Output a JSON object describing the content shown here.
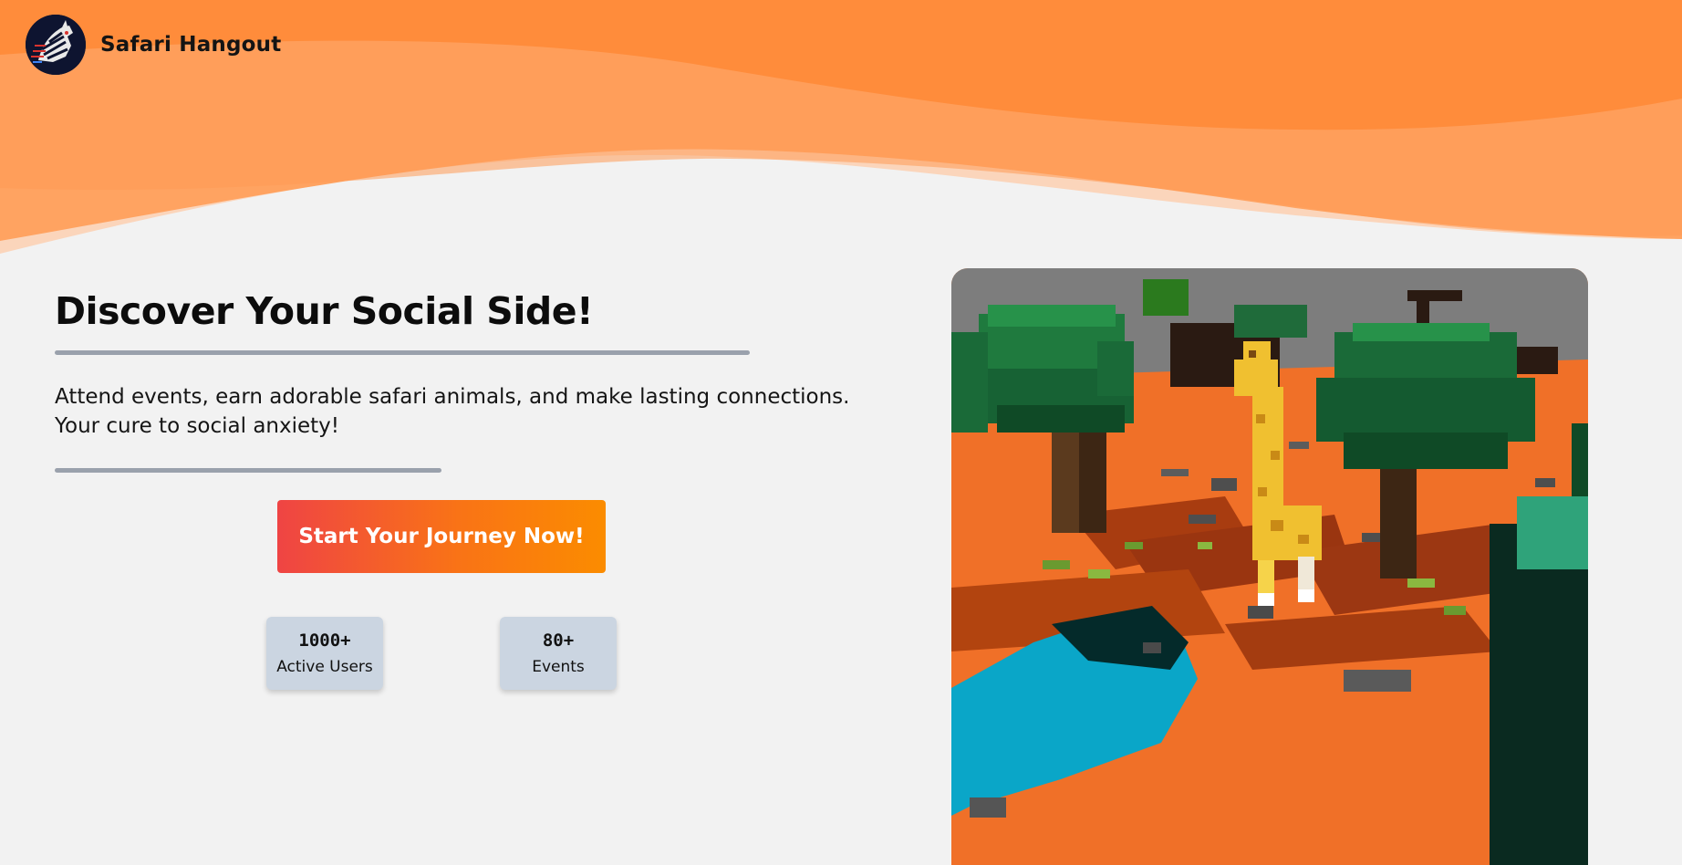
{
  "brand": {
    "name": "Safari Hangout",
    "logo_icon": "zebra-logo-icon"
  },
  "hero": {
    "title": "Discover Your Social Side!",
    "description_line1": "Attend events, earn adorable safari animals, and make lasting connections.",
    "description_line2": "Your cure to social anxiety!",
    "cta_label": "Start Your Journey Now!"
  },
  "stats": [
    {
      "value": "1000+",
      "label": "Active Users"
    },
    {
      "value": "80+",
      "label": "Events"
    }
  ],
  "scene": {
    "description_icon": "voxel-safari-giraffe-scene"
  },
  "colors": {
    "header_orange": "#ff8c3b",
    "page_background": "#f2f2f2",
    "cta_gradient_start": "#ef4444",
    "cta_gradient_end": "#fb8c00",
    "stat_card": "#cbd5e1",
    "rule": "#9aa1ac"
  }
}
